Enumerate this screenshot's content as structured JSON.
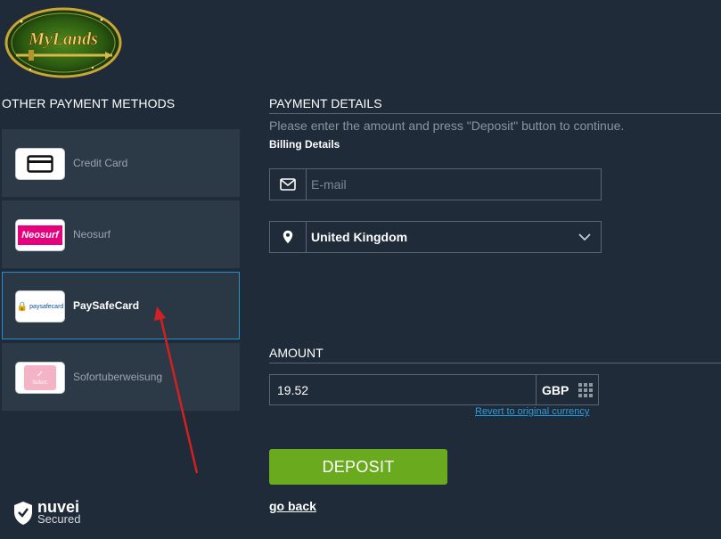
{
  "brand": {
    "logo_text": "MyLands"
  },
  "methods": {
    "title": "OTHER PAYMENT METHODS",
    "items": [
      {
        "label": "Credit Card",
        "icon": "credit-card-icon",
        "selected": false
      },
      {
        "label": "Neosurf",
        "icon": "neosurf-logo",
        "logo_text": "Neosurf",
        "selected": false
      },
      {
        "label": "PaySafeCard",
        "icon": "paysafecard-logo",
        "logo_text": "paysafecard",
        "selected": true
      },
      {
        "label": "Sofortuberweisung",
        "icon": "sofort-logo",
        "logo_text": "Sofort.",
        "selected": false
      }
    ]
  },
  "details": {
    "title": "PAYMENT DETAILS",
    "hint": "Please enter the amount and press \"Deposit\" button to continue.",
    "billing_label": "Billing Details",
    "email_placeholder": "E-mail",
    "country": "United Kingdom"
  },
  "amount": {
    "title": "AMOUNT",
    "value": "19.52",
    "currency": "GBP",
    "revert_link": "Revert to original currency"
  },
  "actions": {
    "deposit_label": "DEPOSIT",
    "go_back_label": "go back"
  },
  "footer": {
    "brand": "nuvei",
    "secured": "Secured"
  },
  "colors": {
    "background": "#1f2b38",
    "panel": "#2c3a48",
    "selected_border": "#2a8fd0",
    "deposit_button": "#6aaa1e",
    "link": "#2a9de0",
    "annotation_arrow": "#d42020"
  }
}
